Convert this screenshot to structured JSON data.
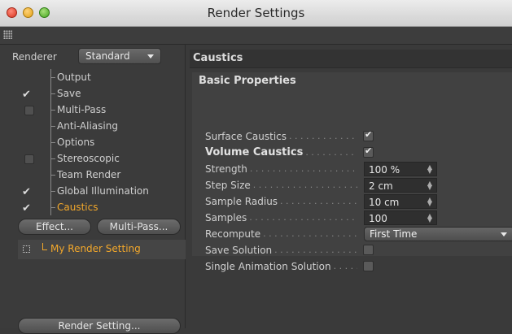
{
  "window": {
    "title": "Render Settings"
  },
  "left": {
    "renderer_label": "Renderer",
    "renderer_value": "Standard",
    "tree": [
      {
        "label": "Output",
        "state": "none"
      },
      {
        "label": "Save",
        "state": "checked"
      },
      {
        "label": "Multi-Pass",
        "state": "unchecked"
      },
      {
        "label": "Anti-Aliasing",
        "state": "none"
      },
      {
        "label": "Options",
        "state": "none"
      },
      {
        "label": "Stereoscopic",
        "state": "unchecked"
      },
      {
        "label": "Team Render",
        "state": "none"
      },
      {
        "label": "Global Illumination",
        "state": "checked"
      },
      {
        "label": "Caustics",
        "state": "checked",
        "active": true
      }
    ],
    "effect_button": "Effect...",
    "multipass_button": "Multi-Pass...",
    "render_setting_name": "My Render Setting",
    "render_setting_button": "Render Setting..."
  },
  "right": {
    "section_title": "Caustics",
    "group_title": "Basic Properties",
    "props": [
      {
        "label": "Surface Caustics",
        "type": "check",
        "checked": true
      },
      {
        "label": "Volume Caustics",
        "type": "check",
        "checked": true,
        "bold": true
      },
      {
        "label": "Strength",
        "type": "field",
        "value": "100 %"
      },
      {
        "label": "Step Size",
        "type": "field",
        "value": "2 cm"
      },
      {
        "label": "Sample Radius",
        "type": "field",
        "value": "10 cm"
      },
      {
        "label": "Samples",
        "type": "field",
        "value": "100"
      },
      {
        "label": "Recompute",
        "type": "select",
        "value": "First Time"
      },
      {
        "label": "Save Solution",
        "type": "check",
        "checked": false
      },
      {
        "label": "Single Animation Solution",
        "type": "check",
        "checked": false
      }
    ]
  },
  "colors": {
    "accent_orange": "#f3a82b",
    "panel_bg": "#3a3a3a"
  }
}
